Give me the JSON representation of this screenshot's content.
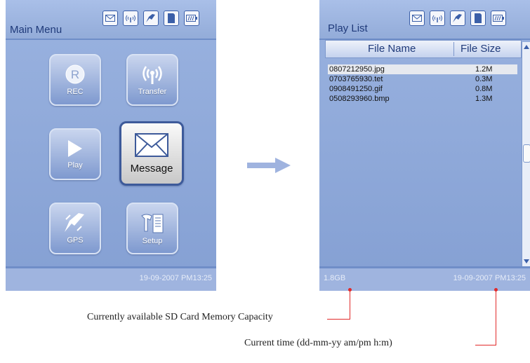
{
  "main_menu": {
    "title": "Main Menu",
    "status_icons": [
      "envelope-icon",
      "signal-icon",
      "satellite-icon",
      "sd-card-icon",
      "battery-icon"
    ],
    "apps": [
      {
        "label": "REC",
        "icon": "rec-icon"
      },
      {
        "label": "Transfer",
        "icon": "antenna-icon"
      },
      {
        "label": "Play",
        "icon": "play-icon"
      },
      {
        "label": "Message",
        "icon": "envelope-icon",
        "selected": true
      },
      {
        "label": "GPS",
        "icon": "satellite-icon"
      },
      {
        "label": "Setup",
        "icon": "setup-icon"
      }
    ],
    "footer_time": "19-09-2007  PM13:25"
  },
  "playlist": {
    "title": "Play List",
    "header_name": "File Name",
    "header_size": "File Size",
    "files": [
      {
        "name": "0807212950.jpg",
        "size": "1.2M",
        "selected": true
      },
      {
        "name": "0703765930.tet",
        "size": "0.3M"
      },
      {
        "name": "0908491250.gif",
        "size": "0.8M"
      },
      {
        "name": "0508293960.bmp",
        "size": "1.3M"
      }
    ],
    "footer_capacity": "1.8GB",
    "footer_time": "19-09-2007  PM13:25"
  },
  "annotations": {
    "capacity": "Currently available SD Card Memory Capacity",
    "time": "Current time (dd-mm-yy am/pm h:m)"
  },
  "colors": {
    "accent": "#1f3a7a",
    "screen_bg": "#8fa8d8",
    "annotation": "#e12a2a"
  }
}
